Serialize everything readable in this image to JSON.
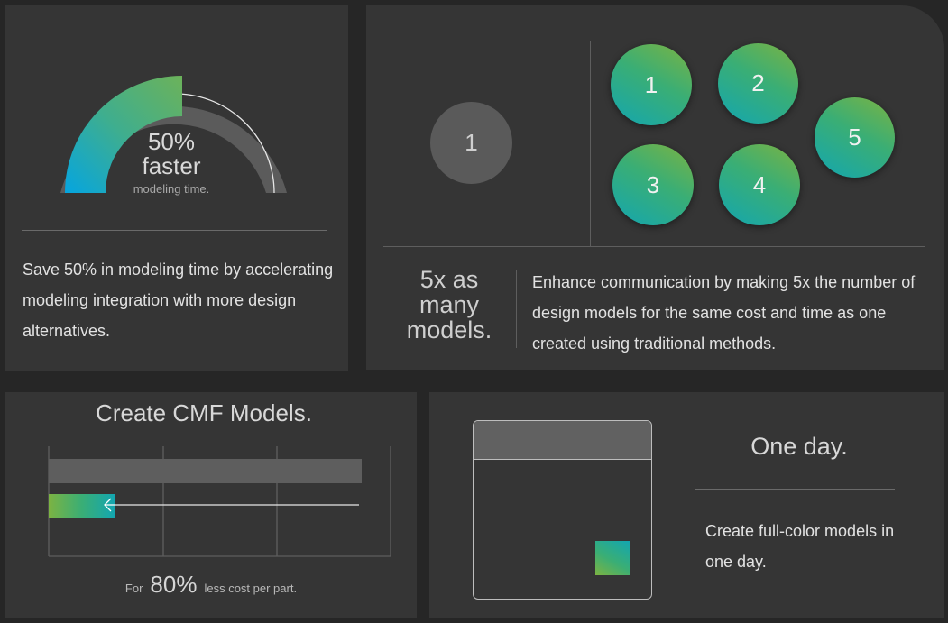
{
  "panel_speed": {
    "gauge_percent_value": 50,
    "gauge_percent": "50%",
    "gauge_word": "faster",
    "gauge_subtitle": "modeling time.",
    "description": "Save 50% in modeling time by accelerating modeling integration with more design alternatives."
  },
  "panel_models": {
    "single_label": "1",
    "circles": [
      "1",
      "2",
      "3",
      "4",
      "5"
    ],
    "headline_line1": "5x as",
    "headline_line2": "many",
    "headline_line3": "models.",
    "description": "Enhance communication by making 5x the number of design models for the same cost and time as one created using traditional methods."
  },
  "panel_cmf": {
    "title": "Create CMF Models.",
    "footer_prefix": "For",
    "footer_value": "80%",
    "footer_suffix": "less cost per part."
  },
  "panel_day": {
    "title": "One day.",
    "description": "Create full-color models in one day."
  },
  "colors": {
    "background": "#262626",
    "panel": "#353535",
    "gradient_green": "#7cb342",
    "gradient_teal": "#3aae75",
    "gradient_blue": "#13a6b0"
  }
}
